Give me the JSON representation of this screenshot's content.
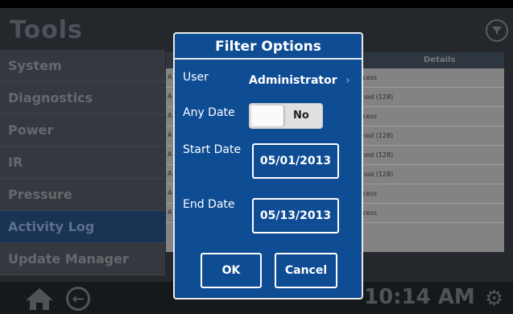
{
  "app": {
    "title": "Tools"
  },
  "sidebar": {
    "items": [
      {
        "label": "System"
      },
      {
        "label": "Diagnostics"
      },
      {
        "label": "Power"
      },
      {
        "label": "IR"
      },
      {
        "label": "Pressure"
      },
      {
        "label": "Activity Log"
      },
      {
        "label": "Update Manager"
      }
    ]
  },
  "table": {
    "header_details": "Details",
    "rows": [
      {
        "c1": "A",
        "c2": "ccess"
      },
      {
        "c1": "A",
        "c2": "thod (128)"
      },
      {
        "c1": "A",
        "c2": "ccess"
      },
      {
        "c1": "A",
        "c2": "thod (128)"
      },
      {
        "c1": "A",
        "c2": "thod (128)"
      },
      {
        "c1": "A",
        "c2": "thod (128)"
      },
      {
        "c1": "A",
        "c2": "ccess"
      },
      {
        "c1": "A",
        "c2": "ccess"
      }
    ]
  },
  "footer": {
    "time": "10:14 AM"
  },
  "dialog": {
    "title": "Filter Options",
    "user_label": "User",
    "user_value": "Administrator",
    "user_chevron": "›",
    "any_date_label": "Any Date",
    "toggle_value": "No",
    "start_date_label": "Start Date",
    "start_date_value": "05/01/2013",
    "end_date_label": "End Date",
    "end_date_value": "05/13/2013",
    "ok_label": "OK",
    "cancel_label": "Cancel"
  },
  "colors": {
    "dialog_bg": "#0e4c94",
    "active_sidebar": "#1f3b63",
    "screen_bg": "#2b3036"
  }
}
